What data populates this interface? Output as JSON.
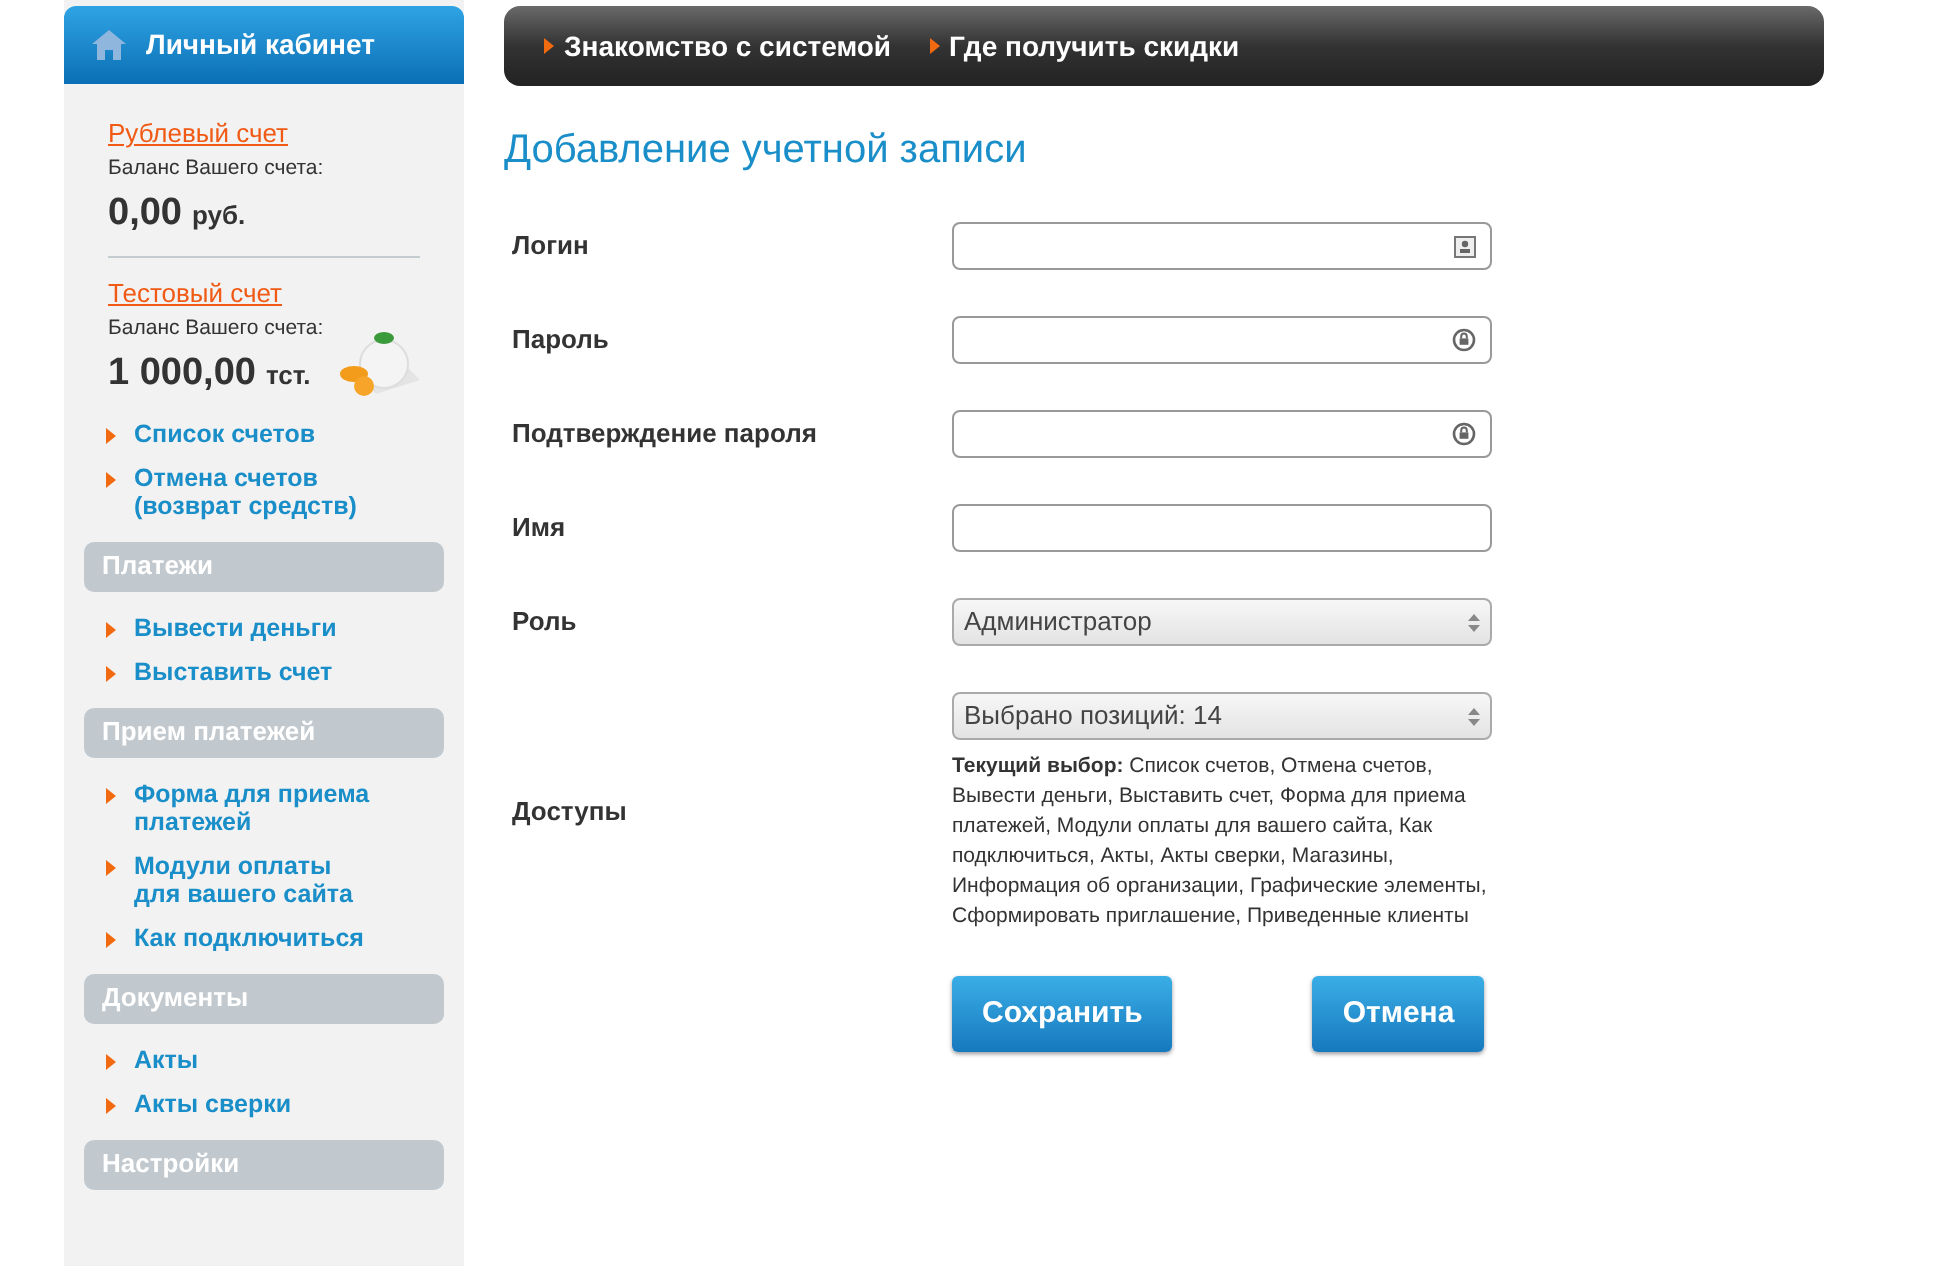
{
  "sidebar": {
    "header": "Личный кабинет",
    "accounts": [
      {
        "name": "Рублевый счет",
        "balance_label": "Баланс Вашего счета:",
        "amount": "0,00",
        "currency": "руб."
      },
      {
        "name": "Тестовый счет",
        "balance_label": "Баланс Вашего счета:",
        "amount": "1 000,00",
        "currency": "тст."
      }
    ],
    "links": [
      "Список счетов",
      "Отмена счетов (возврат средств)"
    ],
    "sections": [
      {
        "title": "Платежи",
        "links": [
          "Вывести деньги",
          "Выставить счет"
        ]
      },
      {
        "title": "Прием платежей",
        "links": [
          "Форма для приема платежей",
          "Модули оплаты для вашего сайта",
          "Как подключиться"
        ]
      },
      {
        "title": "Документы",
        "links": [
          "Акты",
          "Акты сверки"
        ]
      },
      {
        "title": "Настройки"
      }
    ]
  },
  "top_nav": [
    "Знакомство с системой",
    "Где получить скидки"
  ],
  "form": {
    "title": "Добавление учетной записи",
    "fields": [
      {
        "label": "Логин",
        "kind": "login"
      },
      {
        "label": "Пароль",
        "kind": "password"
      },
      {
        "label": "Подтверждение пароля",
        "kind": "password"
      },
      {
        "label": "Имя",
        "kind": "plain"
      },
      {
        "label": "Роль",
        "kind": "select",
        "value": "Администратор"
      }
    ],
    "access": {
      "label": "Доступы",
      "value": "Выбрано позиций: 14",
      "summary": "**Текущий выбор:** Список счетов, Отмена счетов, Вывести деньги, Выставить счет, Форма для приема платежей, Модули оплаты для вашего сайта, Как подключиться, Акты, Акты сверки, Магазины, Информация об организации, Графические элементы, Сформировать приглашение, Приведенные клиенты"
    },
    "buttons": [
      "Сохранить",
      "Отмена"
    ]
  }
}
